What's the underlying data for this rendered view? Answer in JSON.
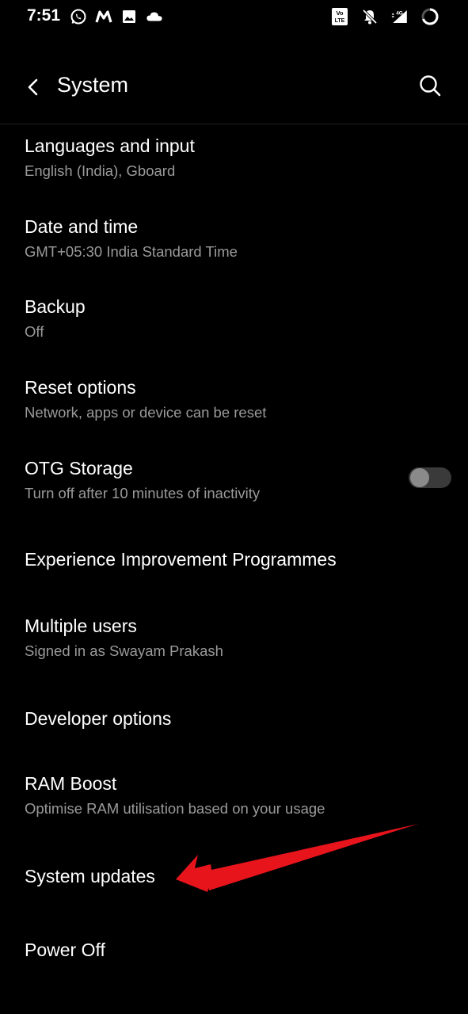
{
  "status_bar": {
    "time": "7:51",
    "left_icons": [
      "whatsapp-icon",
      "m-app-icon",
      "gallery-icon",
      "cloud-icon"
    ],
    "right_icons": [
      "volte-icon",
      "notifications-off-icon",
      "signal-4g-icon",
      "battery-ring-icon"
    ],
    "network_label": "4G"
  },
  "header": {
    "title": "System",
    "back_icon": "chevron-left-icon",
    "search_icon": "search-icon"
  },
  "settings": [
    {
      "title": "Languages and input",
      "summary": "English (India), Gboard"
    },
    {
      "title": "Date and time",
      "summary": "GMT+05:30 India Standard Time"
    },
    {
      "title": "Backup",
      "summary": "Off"
    },
    {
      "title": "Reset options",
      "summary": "Network, apps or device can be reset"
    },
    {
      "title": "OTG Storage",
      "summary": "Turn off after 10 minutes of inactivity",
      "toggle": "off"
    },
    {
      "title": "Experience Improvement Programmes",
      "summary": ""
    },
    {
      "title": "Multiple users",
      "summary": "Signed in as Swayam Prakash"
    },
    {
      "title": "Developer options",
      "summary": ""
    },
    {
      "title": "RAM Boost",
      "summary": "Optimise RAM utilisation based on your usage"
    },
    {
      "title": "System updates",
      "summary": ""
    },
    {
      "title": "Power Off",
      "summary": ""
    }
  ],
  "colors": {
    "background": "#000000",
    "title_text": "#ffffff",
    "summary_text": "#9a9a9a",
    "annotation_arrow": "#e8141c"
  }
}
